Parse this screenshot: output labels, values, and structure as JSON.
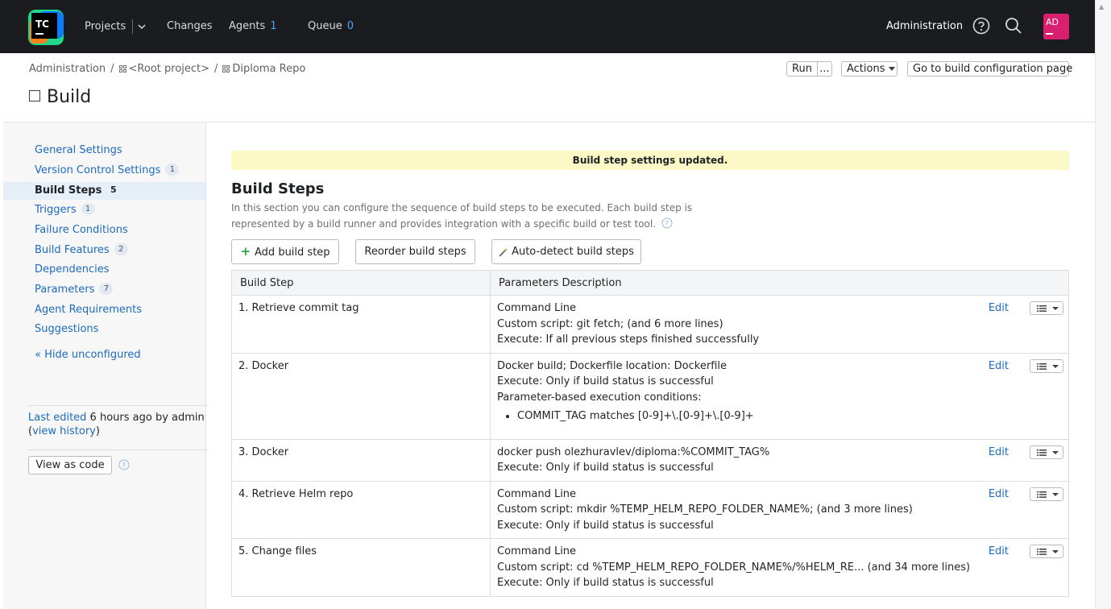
{
  "nav": {
    "logo_text": "TC",
    "projects": "Projects",
    "changes": "Changes",
    "agents": "Agents",
    "agents_count": "1",
    "queue": "Queue",
    "queue_count": "0",
    "administration": "Administration",
    "avatar": "AD"
  },
  "header": {
    "breadcrumb": [
      "Administration",
      "<Root project>",
      "Diploma Repo"
    ],
    "title": "Build",
    "run_label": "Run",
    "run_more": "...",
    "actions_label": "Actions",
    "goto_label": "Go to build configuration page"
  },
  "sidebar": {
    "items": [
      {
        "label": "General Settings",
        "count": ""
      },
      {
        "label": "Version Control Settings",
        "count": "1"
      },
      {
        "label": "Build Steps",
        "count": "5"
      },
      {
        "label": "Triggers",
        "count": "1"
      },
      {
        "label": "Failure Conditions",
        "count": ""
      },
      {
        "label": "Build Features",
        "count": "2"
      },
      {
        "label": "Dependencies",
        "count": ""
      },
      {
        "label": "Parameters",
        "count": "7"
      },
      {
        "label": "Agent Requirements",
        "count": ""
      },
      {
        "label": "Suggestions",
        "count": ""
      }
    ],
    "hide_unconfigured": "« Hide unconfigured",
    "last_edited_link": "Last edited",
    "last_edited_text": " 6 hours ago by admin",
    "view_history_open": "(",
    "view_history": "view history",
    "view_history_close": ")",
    "view_as_code": "View as code"
  },
  "main": {
    "notice": "Build step settings updated.",
    "title": "Build Steps",
    "description": "In this section you can configure the sequence of build steps to be executed. Each build step is represented by a build runner and provides integration with a specific build or test tool.",
    "add_step": "Add build step",
    "reorder_steps": "Reorder build steps",
    "autodetect_steps": "Auto-detect build steps",
    "table": {
      "headers": [
        "Build Step",
        "Parameters Description"
      ],
      "edit_label": "Edit",
      "rows": [
        {
          "name": "1. Retrieve commit tag",
          "lines": [
            "Command Line",
            "Custom script: git fetch; (and 6 more lines)",
            "Execute: If all previous steps finished successfully"
          ]
        },
        {
          "name": "2. Docker",
          "lines": [
            "Docker build; Dockerfile location: Dockerfile",
            "Execute: Only if build status is successful",
            "Parameter-based execution conditions:"
          ],
          "conditions": [
            "COMMIT_TAG matches [0-9]+\\.[0-9]+\\.[0-9]+"
          ]
        },
        {
          "name": "3. Docker",
          "lines": [
            "docker push olezhuravlev/diploma:%COMMIT_TAG%",
            "Execute: Only if build status is successful"
          ]
        },
        {
          "name": "4. Retrieve Helm repo",
          "lines": [
            "Command Line",
            "Custom script: mkdir %TEMP_HELM_REPO_FOLDER_NAME%; (and 3 more lines)",
            "Execute: Only if build status is successful"
          ]
        },
        {
          "name": "5. Change files",
          "lines": [
            "Command Line",
            "Custom script: cd %TEMP_HELM_REPO_FOLDER_NAME%/%HELM_RE... (and 34 more lines)",
            "Execute: Only if build status is successful"
          ]
        }
      ]
    }
  },
  "colors": {
    "topbar": "#1b1c1f",
    "link": "#1c6bbd",
    "notice": "#fdf9c7",
    "avatar": "#d8206e",
    "add_icon": "#2aa54a"
  },
  "icons": [
    "teamcity-logo",
    "chevron-down-icon",
    "help-icon",
    "search-icon",
    "project-icon",
    "checkbox-icon",
    "plus-icon",
    "magic-wand-icon",
    "menu-lines-icon",
    "caret-down-icon"
  ]
}
